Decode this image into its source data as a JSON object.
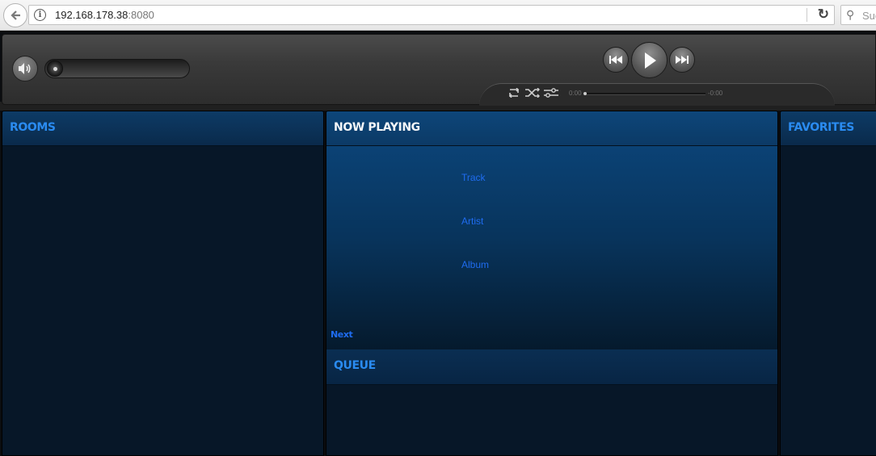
{
  "browser": {
    "url_host": "192.168.178.38",
    "url_port": ":8080",
    "search_placeholder": "Suc"
  },
  "player": {
    "time_elapsed": "0:00",
    "time_remaining": "-0:00",
    "volume_level": 0,
    "progress": 0
  },
  "panels": {
    "rooms": {
      "title": "ROOMS"
    },
    "now_playing": {
      "title": "NOW PLAYING",
      "track": "Track",
      "artist": "Artist",
      "album": "Album",
      "next": "Next"
    },
    "queue": {
      "title": "QUEUE"
    },
    "favorites": {
      "title": "FAVORITES"
    }
  },
  "icons": {
    "back": "back-arrow-icon",
    "info": "info-icon",
    "reload": "reload-icon",
    "search": "search-icon",
    "volume": "speaker-icon",
    "prev": "previous-track-icon",
    "play": "play-icon",
    "next": "next-track-icon",
    "repeat": "repeat-icon",
    "shuffle": "shuffle-icon",
    "crossfade": "equalizer-icon"
  },
  "colors": {
    "accent_blue": "#2a8bf0",
    "track_text_blue": "#1f6cf0",
    "panel_bg": "#071728"
  }
}
